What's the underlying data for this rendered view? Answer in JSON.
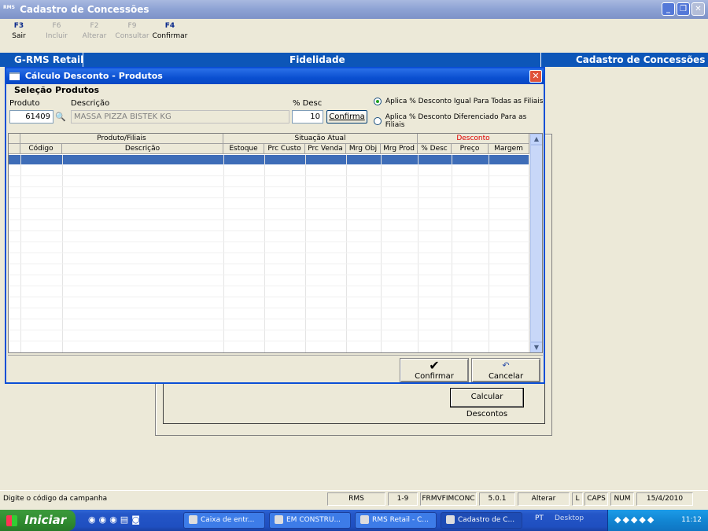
{
  "main": {
    "logo": "RMS",
    "title": "Cadastro de Concessões"
  },
  "fkeys": [
    {
      "key": "F3",
      "label": "Sair",
      "enabled": true
    },
    {
      "key": "F6",
      "label": "Incluir",
      "enabled": false
    },
    {
      "key": "F2",
      "label": "Alterar",
      "enabled": false
    },
    {
      "key": "F9",
      "label": "Consultar",
      "enabled": false
    },
    {
      "key": "F4",
      "label": "Confirmar",
      "enabled": true
    }
  ],
  "band": {
    "left": "G-RMS Retail",
    "center": "Fidelidade",
    "right": "Cadastro de Concessões"
  },
  "background": {
    "calc_button": "Calcular Descontos"
  },
  "dialog": {
    "title": "Cálculo Desconto - Produtos",
    "section": "Seleção Produtos",
    "produto_label": "Produto",
    "produto_value": "61409",
    "descricao_label": "Descrição",
    "descricao_value": "MASSA PIZZA BISTEK KG",
    "desc_label": "% Desc",
    "desc_value": "10",
    "confirma_button": "Confirma",
    "radio1": "Aplica % Desconto Igual Para Todas as Filiais",
    "radio2": "Aplica % Desconto Diferenciado Para as Filiais",
    "radio_selected": 1,
    "grid": {
      "groups": [
        "Produto/Filiais",
        "Situação Atual",
        "Desconto"
      ],
      "columns": [
        "Código",
        "Descrição",
        "Estoque",
        "Prc Custo",
        "Prc Venda",
        "Mrg Obj",
        "Mrg Prod",
        "% Desc",
        "Preço",
        "Margem"
      ]
    },
    "confirmar_button": "Confirmar",
    "cancelar_button": "Cancelar"
  },
  "status": {
    "message": "Digite o código da campanha",
    "cells": [
      "RMS",
      "1-9",
      "FRMVFIMCONC",
      "5.0.1",
      "Alterar",
      "L",
      "CAPS",
      "NUM",
      "15/4/2010"
    ]
  },
  "taskbar": {
    "start": "Iniciar",
    "tasks": [
      "Caixa de entr...",
      "EM CONSTRU...",
      "RMS Retail - C...",
      "Cadastro de C..."
    ],
    "lang": "PT",
    "desktop": "Desktop",
    "clock": "11:12"
  },
  "colors": {
    "band": "#0d56b8",
    "dialog_title": "#0a4fd0",
    "selected_row": "#3e6db8",
    "desconto_header": "#e00000"
  }
}
